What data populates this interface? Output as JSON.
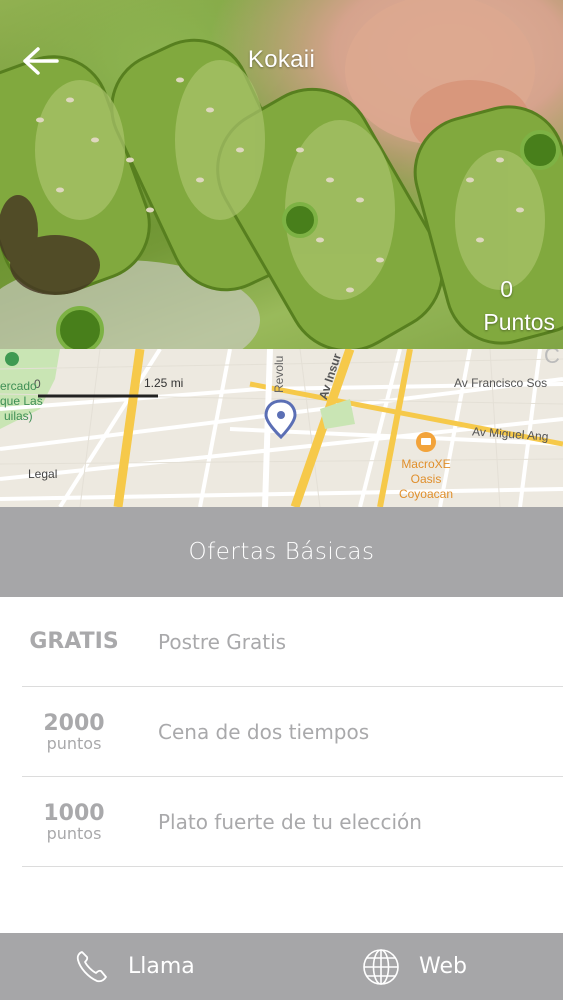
{
  "header": {
    "title": "Kokaii",
    "points_value": "0",
    "points_label": "Puntos"
  },
  "icons": {
    "back": "arrow-left-icon",
    "map_pin": "map-pin-icon",
    "place": "fastfood-icon",
    "phone": "phone-icon",
    "web": "globe-icon"
  },
  "map": {
    "scale_zero": "0",
    "scale_label": "1.25 mi",
    "legal": "Legal",
    "streets": [
      "Revolu",
      "Av Insur",
      "Av Francisco Sos",
      "Av Miguel Ang"
    ],
    "park_lines": [
      "ercado",
      "que Las",
      "uilas)"
    ],
    "poi_lines": [
      "MacroXE",
      "Oasis",
      "Coyoacan"
    ],
    "corner_letter": "C"
  },
  "offers_section": {
    "title": "Ofertas Básicas",
    "items": [
      {
        "cost": "GRATIS",
        "unit": "",
        "description": "Postre Gratis"
      },
      {
        "cost": "2000",
        "unit": "puntos",
        "description": "Cena de dos tiempos"
      },
      {
        "cost": "1000",
        "unit": "puntos",
        "description": "Plato fuerte de tu elección"
      }
    ]
  },
  "footer": {
    "call_label": "Llama",
    "web_label": "Web"
  },
  "colors": {
    "bar_gray": "#a6a6a8",
    "text_gray": "#a9a9ab",
    "pin_blue": "#5b6fb5",
    "road_yellow": "#f6c94a"
  }
}
